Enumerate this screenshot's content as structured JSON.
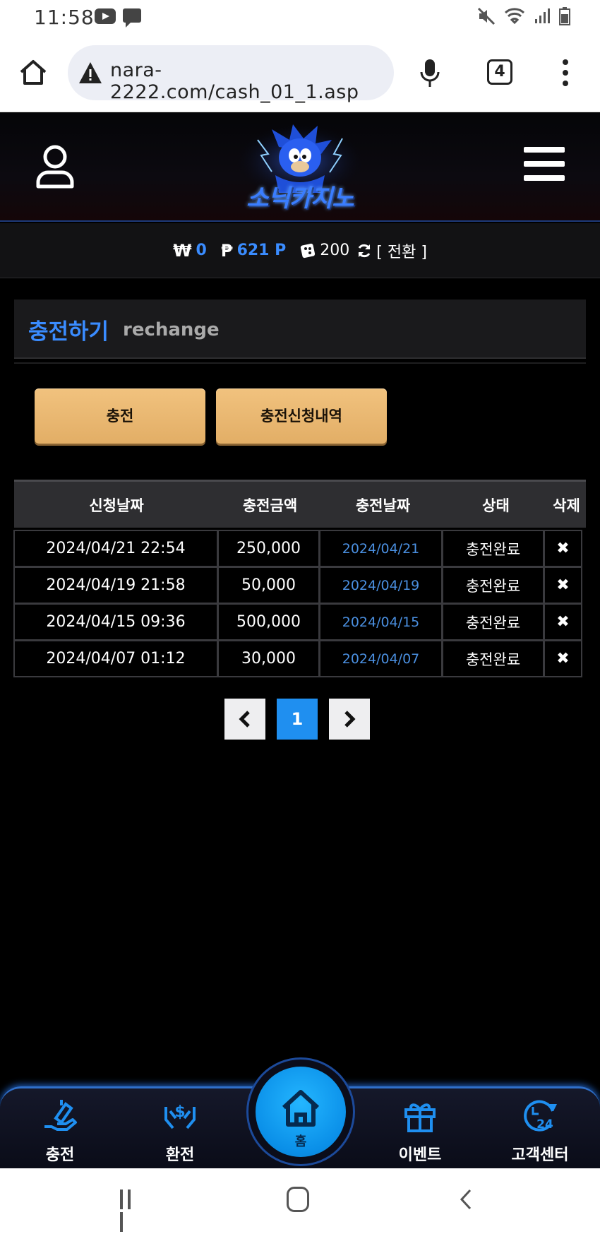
{
  "status_bar": {
    "time": "11:58"
  },
  "browser": {
    "url": "nara-2222.com/cash_01_1.asp",
    "tab_count": "4"
  },
  "site": {
    "logo_text": "소닉카지노"
  },
  "balance": {
    "won_symbol": "₩",
    "won_value": "0",
    "point_symbol": "₱",
    "point_value": "621 P",
    "chip_value": "200",
    "convert_label": "[ 전환 ]"
  },
  "section": {
    "title_ko": "충전하기",
    "title_en": "rechange"
  },
  "buttons": {
    "charge": "충전",
    "history": "충전신청내역"
  },
  "table": {
    "headers": [
      "신청날짜",
      "충전금액",
      "충전날짜",
      "상태",
      "삭제"
    ],
    "rows": [
      {
        "request_date": "2024/04/21 22:54",
        "amount": "250,000",
        "charge_date": "2024/04/21",
        "status": "충전완료"
      },
      {
        "request_date": "2024/04/19 21:58",
        "amount": "50,000",
        "charge_date": "2024/04/19",
        "status": "충전완료"
      },
      {
        "request_date": "2024/04/15 09:36",
        "amount": "500,000",
        "charge_date": "2024/04/15",
        "status": "충전완료"
      },
      {
        "request_date": "2024/04/07 01:12",
        "amount": "30,000",
        "charge_date": "2024/04/07",
        "status": "충전완료"
      }
    ]
  },
  "pagination": {
    "current": "1"
  },
  "bottom_nav": {
    "charge": "충전",
    "exchange": "환전",
    "home": "홈",
    "event": "이벤트",
    "support": "고객센터"
  },
  "colors": {
    "accent": "#3a8cff",
    "gold": "#e9b872",
    "home": "#1f9ff0"
  }
}
